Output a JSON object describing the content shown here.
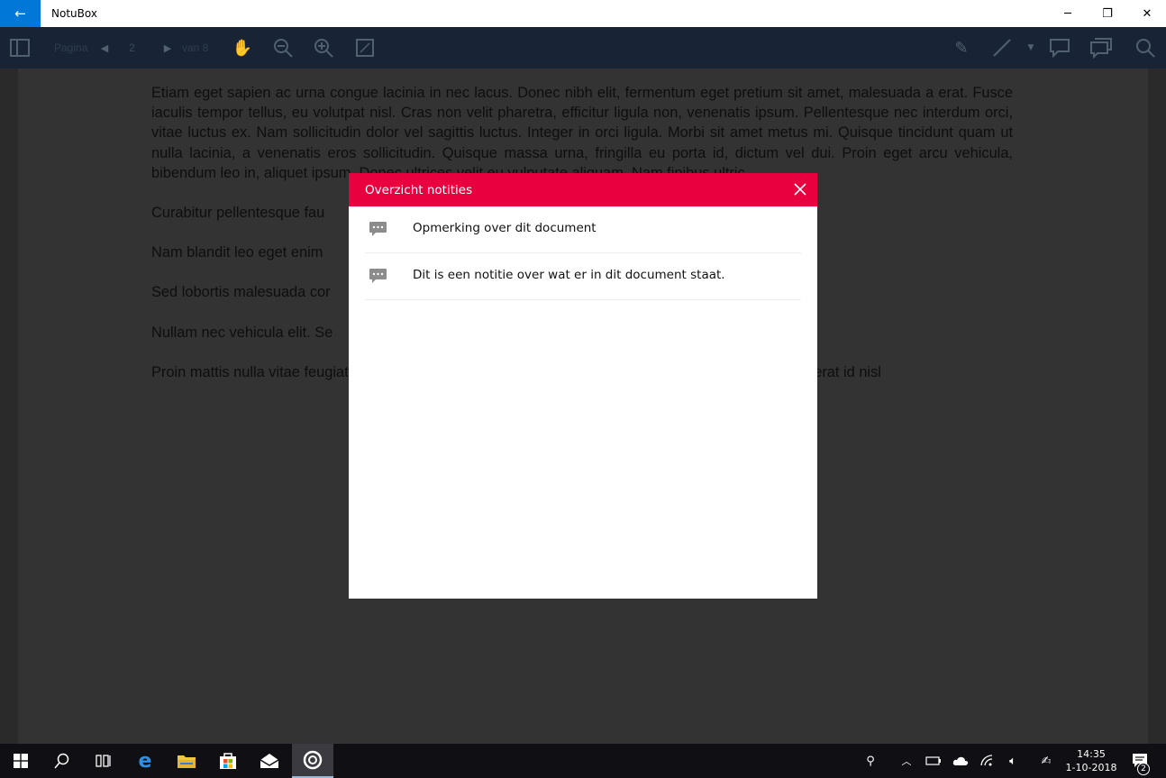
{
  "titlebar": {
    "app_title": "NotuBox",
    "back_icon": "←",
    "minimize_icon": "─",
    "restore_icon": "❐",
    "close_icon": "✕"
  },
  "toolbar": {
    "page_label": "Pagina",
    "page_value": "2",
    "page_total_label": "van 8"
  },
  "document": {
    "paragraphs": [
      "Etiam eget sapien ac urna congue lacinia in nec lacus. Donec nibh elit, fermentum eget pretium sit amet, malesuada a erat. Fusce iaculis tempor tellus, eu volutpat nisl. Cras non velit pharetra, efficitur ligula non, venenatis ipsum. Pellentesque nec interdum orci, vitae luctus ex. Nam sollicitudin dolor vel sagittis luctus. Integer in orci ligula. Morbi sit amet metus mi. Quisque tincidunt quam ut nulla lacinia, a venenatis eros sollicitudin. Quisque massa urna, fringilla eu porta id, dictum vel dui. Proin eget arcu vehicula, bibendum leo in, aliquet ipsum. Donec ultrices velit eu vulputate aliquam. Nam finibus ultric",
      "Curabitur pellentesque fau",
      "Nam blandit leo eget enim",
      "Sed lobortis malesuada cor",
      "Nullam nec vehicula elit. Se",
      "Proin mattis nulla vitae feugiat sagittis. Maecenas vitae pulvinar odio, ac pulvinar arcu. Nullam auctor erat id nisl"
    ]
  },
  "modal": {
    "title": "Overzicht notities",
    "notes": [
      {
        "text": "Opmerking over dit document"
      },
      {
        "text": "Dit is een notitie over wat er in dit document staat."
      }
    ]
  },
  "taskbar": {
    "time": "14:35",
    "date": "1-10-2018",
    "notification_count": "2"
  },
  "colors": {
    "accent_blue": "#0078d7",
    "modal_header_red": "#e8003f",
    "toolbar_navy": "#182436",
    "taskbar": "#0f0f14"
  }
}
